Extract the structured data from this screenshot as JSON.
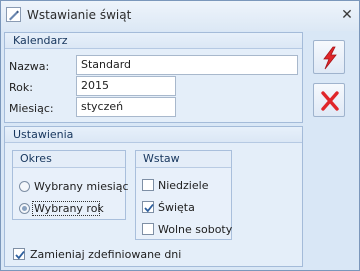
{
  "window": {
    "title": "Wstawianie świąt",
    "close_glyph": "✕"
  },
  "calendar": {
    "header": "Kalendarz",
    "name_label": "Nazwa:",
    "name_value": "Standard",
    "year_label": "Rok:",
    "year_value": "2015",
    "month_label": "Miesiąc:",
    "month_value": "styczeń"
  },
  "settings": {
    "header": "Ustawienia",
    "period": {
      "title": "Okres",
      "options": [
        {
          "label": "Wybrany miesiąc",
          "checked": false
        },
        {
          "label": "Wybrany rok",
          "checked": true
        }
      ]
    },
    "insert": {
      "title": "Wstaw",
      "options": [
        {
          "label": "Niedziele",
          "checked": false
        },
        {
          "label": "Święta",
          "checked": true
        },
        {
          "label": "Wolne soboty",
          "checked": false
        }
      ]
    },
    "replace": {
      "label": "Zamieniaj zdefiniowane dni",
      "checked": true
    }
  },
  "actions": {
    "run_icon": "lightning-icon",
    "cancel_icon": "red-x-icon"
  },
  "colors": {
    "accent_red": "#e0262a",
    "panel_blue": "#e4eef9",
    "header_text": "#17365d"
  }
}
